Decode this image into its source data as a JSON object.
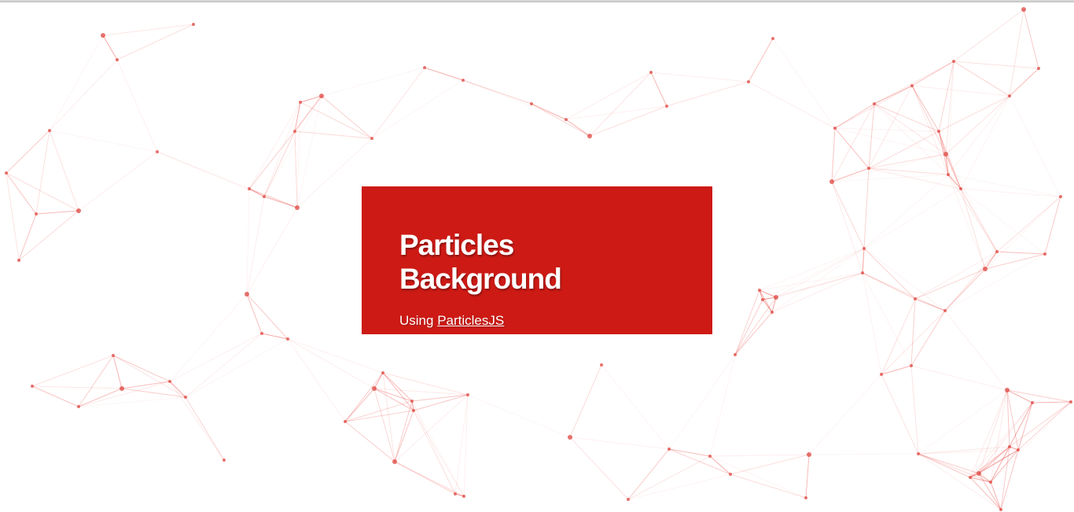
{
  "hero": {
    "title": "Particles Background",
    "subtitle_prefix": "Using",
    "link_label": "ParticlesJS"
  },
  "colors": {
    "card_bg": "#cd1a15",
    "particle": "#e0504a",
    "line": "#e83c36"
  }
}
